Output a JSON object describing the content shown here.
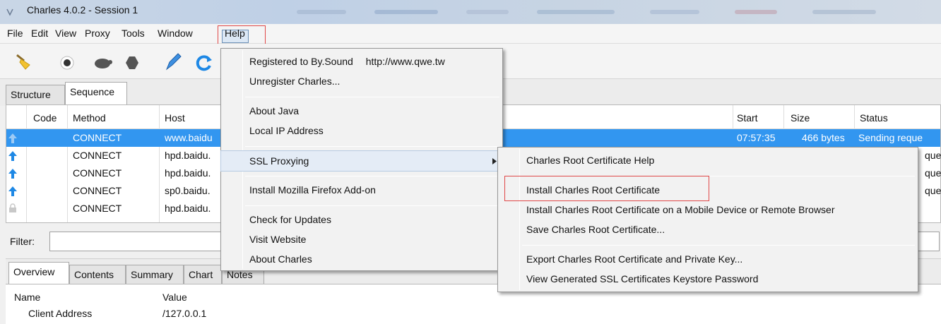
{
  "window": {
    "title": "Charles 4.0.2 - Session 1"
  },
  "menubar": {
    "items": [
      "File",
      "Edit",
      "View",
      "Proxy",
      "Tools",
      "Window",
      "Help"
    ]
  },
  "toolbar": {
    "icons": [
      "broom-icon",
      "record-icon",
      "turtle-icon",
      "stop-hexagon-icon",
      "pen-icon",
      "refresh-icon"
    ]
  },
  "top_tabs": [
    "Structure",
    "Sequence"
  ],
  "table": {
    "columns": [
      "Code",
      "Method",
      "Host",
      "Start",
      "Size",
      "Status"
    ],
    "rows": [
      {
        "method": "CONNECT",
        "host": "www.baidu",
        "start": "07:57:35",
        "size": "466 bytes",
        "status": "Sending reque",
        "selected": true
      },
      {
        "method": "CONNECT",
        "host": "hpd.baidu.",
        "status": "que"
      },
      {
        "method": "CONNECT",
        "host": "hpd.baidu.",
        "status": "que"
      },
      {
        "method": "CONNECT",
        "host": "sp0.baidu.",
        "status": "que"
      },
      {
        "method": "CONNECT",
        "host": "hpd.baidu.",
        "status": ""
      }
    ]
  },
  "filter": {
    "label": "Filter:",
    "value": ""
  },
  "bottom_tabs": [
    "Overview",
    "Contents",
    "Summary",
    "Chart",
    "Notes"
  ],
  "detail": {
    "headers": [
      "Name",
      "Value"
    ],
    "rows": [
      {
        "name": "Client Address",
        "value": "/127.0.0.1"
      }
    ]
  },
  "help_menu": {
    "registered": "Registered to By.Sound",
    "registered_url": "http://www.qwe.tw",
    "unregister": "Unregister Charles...",
    "about_java": "About Java",
    "local_ip": "Local IP Address",
    "ssl_proxying": "SSL Proxying",
    "install_addon": "Install Mozilla Firefox Add-on",
    "check_updates": "Check for Updates",
    "visit_website": "Visit Website",
    "about_charles": "About Charles"
  },
  "ssl_menu": {
    "root_help": "Charles Root Certificate Help",
    "install_root": "Install Charles Root Certificate",
    "install_mobile": "Install Charles Root Certificate on a Mobile Device or Remote Browser",
    "save_root": "Save Charles Root Certificate...",
    "export_key": "Export Charles Root Certificate and Private Key...",
    "view_keystore": "View Generated SSL Certificates Keystore Password"
  },
  "colors": {
    "selection": "#3296f0",
    "highlight_box": "#e04848",
    "arrow": "#1e88e5"
  }
}
